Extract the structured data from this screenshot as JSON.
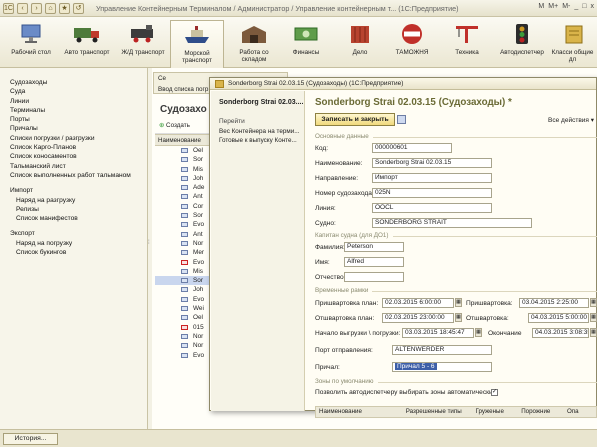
{
  "app": {
    "window_title": "Управление Контейнерным Терминалом / Администратор / Управление контейнерным т... (1С:Предприятие)",
    "window_controls": [
      "M",
      "M+",
      "M-",
      "_",
      "□",
      "x"
    ]
  },
  "toolbar": {
    "items": [
      {
        "label": "Рабочий стол",
        "icon": "desktop-icon"
      },
      {
        "label": "Авто транспорт",
        "icon": "truck-icon"
      },
      {
        "label": "Ж/Д транспорт",
        "icon": "train-icon"
      },
      {
        "label": "Морской транспорт",
        "icon": "ship-icon"
      },
      {
        "label": "Работа со складом",
        "icon": "warehouse-icon"
      },
      {
        "label": "Финансы",
        "icon": "money-icon"
      },
      {
        "label": "Дело",
        "icon": "container-icon"
      },
      {
        "label": "ТАМОЖНЯ",
        "icon": "customs-icon"
      },
      {
        "label": "Техника",
        "icon": "crane-icon"
      },
      {
        "label": "Автодиспетчер",
        "icon": "traffic-light-icon"
      },
      {
        "label": "Класси общие дл",
        "icon": "classifier-icon"
      }
    ],
    "active_index": 3
  },
  "sidebar": {
    "items": [
      {
        "label": "Судозаходы",
        "level": 0
      },
      {
        "label": "Суда",
        "level": 0
      },
      {
        "label": "Линии",
        "level": 0
      },
      {
        "label": "Терминалы",
        "level": 0
      },
      {
        "label": "Порты",
        "level": 0
      },
      {
        "label": "Причалы",
        "level": 0
      },
      {
        "label": "Списки погрузки / разгрузки",
        "level": 0
      },
      {
        "label": "Список Карго-Планов",
        "level": 0
      },
      {
        "label": "Список коносаментов",
        "level": 0
      },
      {
        "label": "Тальманский лист",
        "level": 0
      },
      {
        "label": "Список выполненных работ тальманом",
        "level": 0
      },
      {
        "label": "Импорт",
        "level": "section"
      },
      {
        "label": "Наряд на разгрузку",
        "level": 1
      },
      {
        "label": "Релизы",
        "level": 1
      },
      {
        "label": "Список манифестов",
        "level": 1
      },
      {
        "label": "Экспорт",
        "level": "section"
      },
      {
        "label": "Наряд на погрузку",
        "level": 1
      },
      {
        "label": "Список букингов",
        "level": 1
      }
    ]
  },
  "background_form": {
    "tab_top": "Се",
    "tab_label": "Ввод списка погр",
    "header": "Судозахо",
    "create_button": "Создать",
    "column": "Наименование",
    "rows": [
      {
        "text": "Oel",
        "deleted": false,
        "selected": false
      },
      {
        "text": "Sor",
        "deleted": false,
        "selected": false
      },
      {
        "text": "Mis",
        "deleted": false,
        "selected": false
      },
      {
        "text": "Joh",
        "deleted": false,
        "selected": false
      },
      {
        "text": "Ade",
        "deleted": false,
        "selected": false
      },
      {
        "text": "Ant",
        "deleted": false,
        "selected": false
      },
      {
        "text": "Cor",
        "deleted": false,
        "selected": false
      },
      {
        "text": "Sor",
        "deleted": false,
        "selected": false
      },
      {
        "text": "Evo",
        "deleted": false,
        "selected": false
      },
      {
        "text": "Ant",
        "deleted": false,
        "selected": false
      },
      {
        "text": "Nor",
        "deleted": false,
        "selected": false
      },
      {
        "text": "Mer",
        "deleted": false,
        "selected": false
      },
      {
        "text": "Evo",
        "deleted": true,
        "selected": false
      },
      {
        "text": "Mis",
        "deleted": false,
        "selected": false
      },
      {
        "text": "Sor",
        "deleted": false,
        "selected": true
      },
      {
        "text": "Joh",
        "deleted": false,
        "selected": false
      },
      {
        "text": "Evo",
        "deleted": false,
        "selected": false
      },
      {
        "text": "Wei",
        "deleted": false,
        "selected": false
      },
      {
        "text": "Oel",
        "deleted": false,
        "selected": false
      },
      {
        "text": "015",
        "deleted": true,
        "selected": false
      },
      {
        "text": "Nor",
        "deleted": false,
        "selected": false
      },
      {
        "text": "Nor",
        "deleted": false,
        "selected": false
      },
      {
        "text": "Evo",
        "deleted": false,
        "selected": false
      }
    ]
  },
  "status_bar": {
    "history_button": "История..."
  },
  "modal": {
    "window_title": "Sonderborg Strai 02.03.15 (Судозаходы)  (1С:Предприятие)",
    "left": {
      "name": "Sonderborg Strai 02.03....",
      "goto_label": "Перейти",
      "links": [
        "Вес Контейнера на терми...",
        "Готовые к выпуску Конте..."
      ]
    },
    "heading": "Sonderborg Strai 02.03.15 (Судозаходы) *",
    "save_button": "Записать и закрыть",
    "all_actions": "Все действия ▾",
    "sections": {
      "main": "Основные данные",
      "captain": "Капитан судна (для ДО1)",
      "time": "Временные рамки",
      "zones": "Зоны по умолчанию"
    },
    "fields": {
      "code": {
        "label": "Код:",
        "value": "000000601"
      },
      "name": {
        "label": "Наименование:",
        "value": "Sonderborg Strai 02.03.15"
      },
      "direction": {
        "label": "Направление:",
        "value": "Импорт"
      },
      "voyage": {
        "label": "Номер судозахода:",
        "value": "025N"
      },
      "line": {
        "label": "Линия:",
        "value": "OOCL"
      },
      "vessel": {
        "label": "Судно:",
        "value": "SONDERBORG STRAIT"
      },
      "surname": {
        "label": "Фамилия:",
        "value": "Peterson"
      },
      "firstname": {
        "label": "Имя:",
        "value": "Alfred"
      },
      "patronymic": {
        "label": "Отчество:",
        "value": ""
      },
      "moor_plan": {
        "label": "Пришвартовка план:",
        "value": "02.03.2015  6:00:00"
      },
      "moor": {
        "label": "Пришвартовка:",
        "value": "03.04.2015  2:25:00"
      },
      "unmoor_plan": {
        "label": "Отшвартовка план:",
        "value": "02.03.2015 23:00:00"
      },
      "unmoor": {
        "label": "Отшвартовка:",
        "value": "04.03.2015  5:00:00"
      },
      "cargo_start": {
        "label": "Начало выгрузки \\ погрузки:",
        "value": "03.03.2015 18:45:47"
      },
      "cargo_end": {
        "label": "Окончание",
        "value": "04.03.2015  3:08:35"
      },
      "departure_port": {
        "label": "Порт отправления:",
        "value": "ALTENWERDER"
      },
      "berth": {
        "label": "Причал:",
        "value": "Причал 5 - 6"
      },
      "auto_zones": {
        "label": "Позволить автодиспетчеру выбирать зоны автоматически",
        "checked": true
      }
    },
    "zones_table": {
      "columns": [
        "Наименование",
        "Разрешенные типы",
        "Груженые",
        "Порожние",
        "Опа"
      ]
    }
  }
}
